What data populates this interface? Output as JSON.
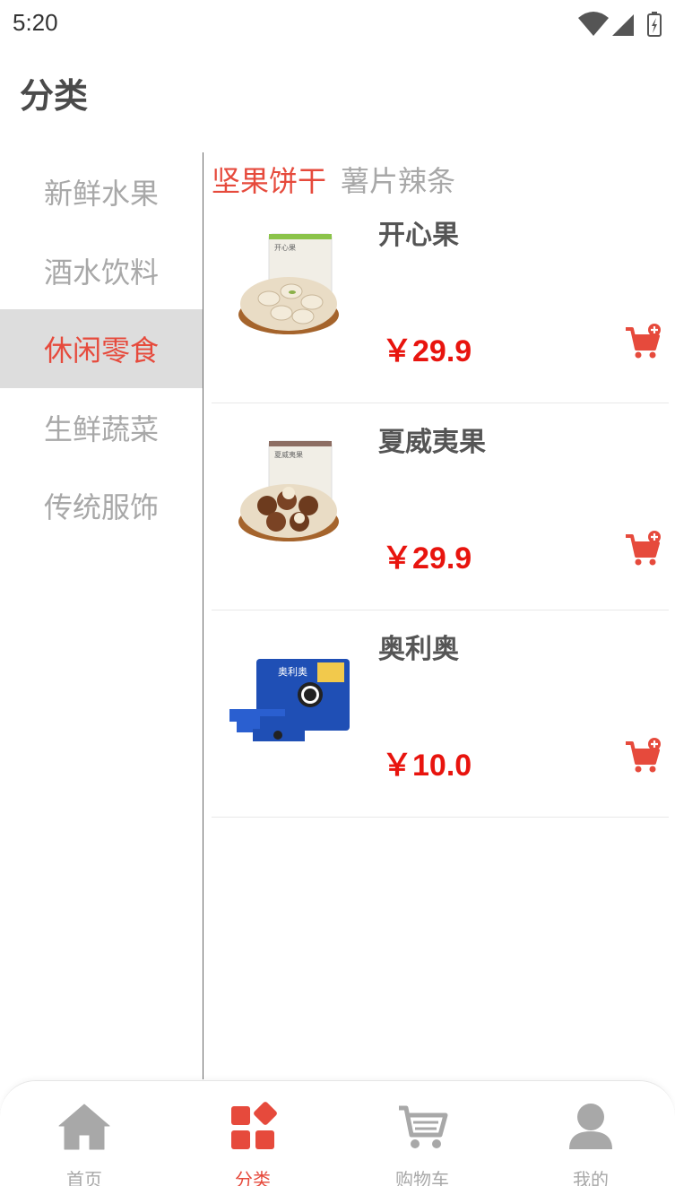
{
  "status_bar": {
    "time": "5:20"
  },
  "header": {
    "title": "分类"
  },
  "sidebar": {
    "items": [
      {
        "label": "新鲜水果"
      },
      {
        "label": "酒水饮料"
      },
      {
        "label": "休闲零食"
      },
      {
        "label": "生鲜蔬菜"
      },
      {
        "label": "传统服饰"
      }
    ],
    "active_index": 2
  },
  "subcategory_tabs": [
    {
      "label": "坚果饼干"
    },
    {
      "label": "薯片辣条"
    }
  ],
  "products": [
    {
      "name": "开心果",
      "price": "￥29.9",
      "image": "pistachio-bowl-image",
      "bag_text": "开心果"
    },
    {
      "name": "夏威夷果",
      "price": "￥29.9",
      "image": "macadamia-bowl-image",
      "bag_text": "夏威夷果"
    },
    {
      "name": "奥利奥",
      "price": "￥10.0",
      "image": "oreo-pack-image",
      "bag_text": "奥利奥"
    }
  ],
  "tabbar": {
    "items": [
      {
        "label": "首页",
        "icon": "home-icon"
      },
      {
        "label": "分类",
        "icon": "category-icon"
      },
      {
        "label": "购物车",
        "icon": "cart-icon"
      },
      {
        "label": "我的",
        "icon": "user-icon"
      }
    ],
    "active_index": 1
  },
  "colors": {
    "accent": "#e64a3c",
    "price": "#e8140e",
    "muted": "#a8a8a8",
    "active_bg": "#dddddd"
  }
}
